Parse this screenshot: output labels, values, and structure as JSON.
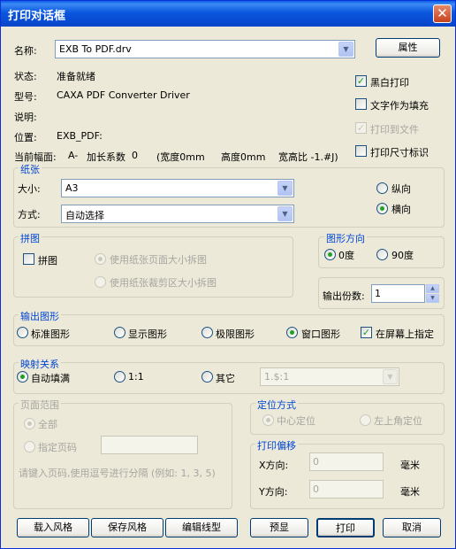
{
  "window": {
    "title": "打印对话框",
    "close_glyph": "✕"
  },
  "printer": {
    "name_label": "名称:",
    "name_value": "EXB To PDF.drv",
    "properties_button": "属性",
    "status_label": "状态:",
    "status_value": "准备就绪",
    "model_label": "型号:",
    "model_value": "CAXA PDF Converter Driver",
    "comment_label": "说明:",
    "location_label": "位置:",
    "location_value": "EXB_PDF:",
    "current_size_label": "当前幅面:",
    "current_size_value": "A-",
    "scale_label": "加长系数",
    "scale_value": "0",
    "width_text": "(宽度0mm",
    "height_text": "高度0mm",
    "ratio_text": "宽高比 -1.#J)"
  },
  "options": {
    "bw_print": "黑白打印",
    "text_as_fill": "文字作为填充",
    "print_to_file": "打印到文件",
    "print_size_mark": "打印尺寸标识"
  },
  "paper": {
    "legend": "纸张",
    "size_label": "大小:",
    "size_value": "A3",
    "mode_label": "方式:",
    "mode_value": "自动选择",
    "portrait": "纵向",
    "landscape": "横向"
  },
  "tiling": {
    "legend": "拼图",
    "tile_checkbox": "拼图",
    "by_page": "使用纸张页面大小拆图",
    "by_clip": "使用纸张裁剪区大小拆图"
  },
  "orientation": {
    "legend": "图形方向",
    "deg0": "0度",
    "deg90": "90度"
  },
  "copies": {
    "label": "输出份数:",
    "value": "1",
    "up": "▲",
    "down": "▼"
  },
  "output": {
    "legend": "输出图形",
    "standard": "标准图形",
    "display": "显示图形",
    "limits": "极限图形",
    "window": "窗口图形",
    "specify_on_screen": "在屏幕上指定"
  },
  "mapping": {
    "legend": "映射关系",
    "auto_fill": "自动填满",
    "one_to_one": "1:1",
    "other": "其它",
    "other_value": "1.$:1"
  },
  "pages": {
    "legend": "页面范围",
    "all": "全部",
    "specified": "指定页码",
    "hint": "请键入页码,使用逗号进行分隔 (例如: 1, 3, 5)"
  },
  "positioning": {
    "legend": "定位方式",
    "center": "中心定位",
    "top_left": "左上角定位"
  },
  "offset": {
    "legend": "打印偏移",
    "x_label": "X方向:",
    "x_value": "0",
    "x_unit": "毫米",
    "y_label": "Y方向:",
    "y_value": "0",
    "y_unit": "毫米"
  },
  "buttons": {
    "load_style": "载入风格",
    "save_style": "保存风格",
    "edit_lines": "编辑线型",
    "preview": "预显",
    "print": "打印",
    "cancel": "取消"
  },
  "dropdown_glyph": "▼",
  "check_glyph": "✓"
}
